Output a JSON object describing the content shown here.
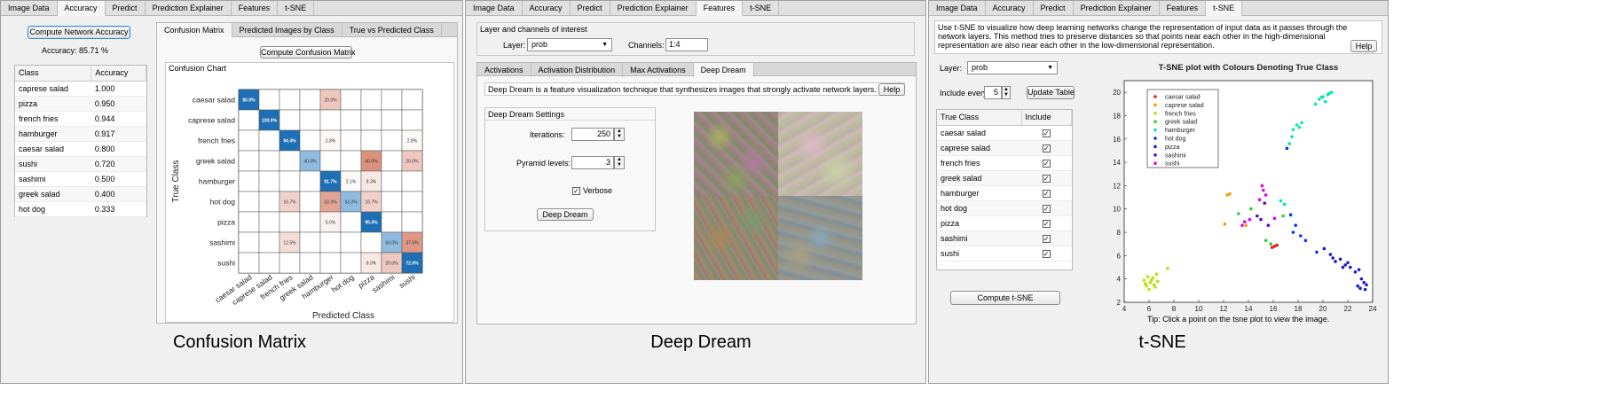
{
  "cm_panel": {
    "tabs": [
      "Image Data",
      "Accuracy",
      "Predict",
      "Prediction Explainer",
      "Features",
      "t-SNE"
    ],
    "active_tab": 1,
    "compute_btn": "Compute Network Accuracy",
    "accuracy_text": "Accuracy: 85.71 %",
    "table_headers": [
      "Class",
      "Accuracy"
    ],
    "table_rows": [
      [
        "caprese salad",
        "1.000"
      ],
      [
        "pizza",
        "0.950"
      ],
      [
        "french fries",
        "0.944"
      ],
      [
        "hamburger",
        "0.917"
      ],
      [
        "caesar salad",
        "0.800"
      ],
      [
        "sushi",
        "0.720"
      ],
      [
        "sashimi",
        "0.500"
      ],
      [
        "greek salad",
        "0.400"
      ],
      [
        "hot dog",
        "0.333"
      ]
    ],
    "subtabs": [
      "Confusion Matrix",
      "Predicted Images by Class",
      "True vs Predicted Class"
    ],
    "compute_cm_btn": "Compute Confusion Matrix",
    "chart_title": "Confusion Chart",
    "caption": "Confusion Matrix"
  },
  "chart_data": [
    {
      "type": "heatmap",
      "title": "Confusion Chart",
      "xlabel": "Predicted Class",
      "ylabel": "True Class",
      "classes": [
        "caesar salad",
        "caprese salad",
        "french fries",
        "greek salad",
        "hamburger",
        "hot dog",
        "pizza",
        "sashimi",
        "sushi"
      ],
      "cells": [
        {
          "row": 0,
          "col": 0,
          "v": "80.0%"
        },
        {
          "row": 0,
          "col": 4,
          "v": "20.0%"
        },
        {
          "row": 1,
          "col": 1,
          "v": "100.0%"
        },
        {
          "row": 2,
          "col": 2,
          "v": "94.4%"
        },
        {
          "row": 2,
          "col": 4,
          "v": "2.8%"
        },
        {
          "row": 2,
          "col": 8,
          "v": "2.8%"
        },
        {
          "row": 3,
          "col": 3,
          "v": "40.0%"
        },
        {
          "row": 3,
          "col": 6,
          "v": "40.0%"
        },
        {
          "row": 3,
          "col": 8,
          "v": "20.0%"
        },
        {
          "row": 4,
          "col": 4,
          "v": "91.7%"
        },
        {
          "row": 4,
          "col": 5,
          "v": "2.1%"
        },
        {
          "row": 4,
          "col": 6,
          "v": "8.3%"
        },
        {
          "row": 5,
          "col": 2,
          "v": "16.7%"
        },
        {
          "row": 5,
          "col": 4,
          "v": "33.3%"
        },
        {
          "row": 5,
          "col": 5,
          "v": "33.3%"
        },
        {
          "row": 5,
          "col": 6,
          "v": "16.7%"
        },
        {
          "row": 6,
          "col": 4,
          "v": "5.0%"
        },
        {
          "row": 6,
          "col": 6,
          "v": "95.0%"
        },
        {
          "row": 7,
          "col": 2,
          "v": "12.5%"
        },
        {
          "row": 7,
          "col": 7,
          "v": "50.0%"
        },
        {
          "row": 7,
          "col": 8,
          "v": "37.5%"
        },
        {
          "row": 8,
          "col": 6,
          "v": "8.0%"
        },
        {
          "row": 8,
          "col": 7,
          "v": "20.0%"
        },
        {
          "row": 8,
          "col": 8,
          "v": "72.0%"
        }
      ]
    },
    {
      "type": "scatter",
      "title": "T-SNE plot with Colours Denoting True Class",
      "xlim": [
        4,
        24
      ],
      "ylim": [
        2,
        21
      ],
      "xticks": [
        "4",
        "6",
        "8",
        "10",
        "12",
        "14",
        "16",
        "18",
        "20",
        "22",
        "24"
      ],
      "yticks": [
        "2",
        "4",
        "6",
        "8",
        "10",
        "12",
        "14",
        "16",
        "18",
        "20"
      ],
      "legend_position": "top-left",
      "series": [
        {
          "name": "caesar salad",
          "color": "#e41a1c",
          "points": [
            [
              16.1,
              6.8
            ],
            [
              16.3,
              6.9
            ],
            [
              15.9,
              6.7
            ]
          ]
        },
        {
          "name": "caprese salad",
          "color": "#ff9900",
          "points": [
            [
              12.3,
              11.2
            ],
            [
              12.5,
              11.3
            ],
            [
              13.8,
              8.6
            ],
            [
              12.1,
              8.7
            ]
          ]
        },
        {
          "name": "french fries",
          "color": "#b3e600",
          "points": [
            [
              5.8,
              3.4
            ],
            [
              6.1,
              3.7
            ],
            [
              6.4,
              3.5
            ],
            [
              5.6,
              3.9
            ],
            [
              6.7,
              3.8
            ],
            [
              5.9,
              4.2
            ],
            [
              6.3,
              4.1
            ],
            [
              6.0,
              3.1
            ],
            [
              6.5,
              3.3
            ],
            [
              5.7,
              3.6
            ],
            [
              6.2,
              3.9
            ],
            [
              7.5,
              4.9
            ],
            [
              6.6,
              4.4
            ]
          ]
        },
        {
          "name": "greek salad",
          "color": "#33cc33",
          "points": [
            [
              15.4,
              7.3
            ],
            [
              16.8,
              9.4
            ],
            [
              14.2,
              10.0
            ],
            [
              13.2,
              9.6
            ],
            [
              15.8,
              7.0
            ]
          ]
        },
        {
          "name": "hamburger",
          "color": "#00e6b8",
          "points": [
            [
              17.3,
              15.6
            ],
            [
              17.6,
              16.8
            ],
            [
              17.9,
              17.2
            ],
            [
              18.3,
              17.4
            ],
            [
              19.4,
              19.0
            ],
            [
              19.7,
              19.4
            ],
            [
              20.0,
              19.6
            ],
            [
              20.4,
              19.8
            ],
            [
              20.7,
              20.0
            ],
            [
              20.2,
              19.2
            ],
            [
              19.9,
              19.6
            ],
            [
              20.5,
              19.9
            ],
            [
              17.5,
              16.2
            ],
            [
              18.1,
              17.0
            ],
            [
              16.9,
              10.4
            ],
            [
              16.6,
              10.7
            ]
          ]
        },
        {
          "name": "hot dog",
          "color": "#0033ff",
          "points": [
            [
              17.1,
              15.2
            ],
            [
              17.4,
              9.5
            ],
            [
              17.8,
              8.6
            ],
            [
              18.2,
              7.7
            ],
            [
              18.6,
              7.3
            ],
            [
              17.6,
              8.0
            ],
            [
              19.5,
              6.3
            ]
          ]
        },
        {
          "name": "pizza",
          "color": "#1a1acc",
          "points": [
            [
              20.1,
              6.6
            ],
            [
              20.6,
              6.1
            ],
            [
              21.0,
              5.5
            ],
            [
              21.4,
              5.7
            ],
            [
              21.8,
              5.2
            ],
            [
              22.2,
              5.0
            ],
            [
              22.6,
              4.6
            ],
            [
              22.9,
              4.8
            ],
            [
              23.1,
              4.0
            ],
            [
              23.3,
              3.7
            ],
            [
              23.5,
              3.5
            ],
            [
              22.8,
              3.4
            ],
            [
              23.0,
              3.2
            ],
            [
              21.6,
              5.0
            ],
            [
              22.0,
              5.4
            ],
            [
              20.8,
              5.8
            ],
            [
              23.4,
              3.1
            ]
          ]
        },
        {
          "name": "sashimi",
          "color": "#6600cc",
          "points": [
            [
              15.0,
              9.1
            ],
            [
              15.3,
              10.5
            ],
            [
              14.7,
              9.4
            ],
            [
              15.6,
              8.6
            ]
          ]
        },
        {
          "name": "sushi",
          "color": "#e600e6",
          "points": [
            [
              15.1,
              12.0
            ],
            [
              15.2,
              11.6
            ],
            [
              15.4,
              11.2
            ],
            [
              14.9,
              10.8
            ],
            [
              13.7,
              8.9
            ],
            [
              13.5,
              8.6
            ],
            [
              16.1,
              9.2
            ],
            [
              14.1,
              9.1
            ]
          ]
        }
      ]
    }
  ],
  "dd_panel": {
    "tabs": [
      "Image Data",
      "Accuracy",
      "Predict",
      "Prediction Explainer",
      "Features",
      "t-SNE"
    ],
    "active_tab": 4,
    "group_title": "Layer and channels of interest",
    "layer_label": "Layer:",
    "layer_value": "prob",
    "channels_label": "Channels:",
    "channels_value": "1:4",
    "subtabs": [
      "Activations",
      "Activation Distribution",
      "Max Activations",
      "Deep Dream"
    ],
    "description": "Deep Dream is a feature visualization technique that synthesizes images that strongly activate network layers.",
    "help": "Help",
    "settings_title": "Deep Dream Settings",
    "iterations_label": "Iterations:",
    "iterations_value": "250",
    "pyramid_label": "Pyramid levels:",
    "pyramid_value": "3",
    "verbose_label": "Verbose",
    "deep_dream_btn": "Deep Dream",
    "caption": "Deep Dream"
  },
  "tsne_panel": {
    "tabs": [
      "Image Data",
      "Accuracy",
      "Predict",
      "Prediction Explainer",
      "Features",
      "t-SNE"
    ],
    "active_tab": 5,
    "description": "Use t-SNE to visualize how deep learning networks change the representation of input data as it passes through the network layers. This method tries to preserve distances so that points near each other in the high-dimensional representation are also near each other in the low-dimensional representation.",
    "help": "Help",
    "layer_label": "Layer:",
    "layer_value": "prob",
    "include_label": "Include every",
    "include_value": "5",
    "update_btn": "Update Table",
    "table_headers": [
      "True Class",
      "Include"
    ],
    "table_rows": [
      "caesar salad",
      "caprese salad",
      "french fries",
      "greek salad",
      "hamburger",
      "hot dog",
      "pizza",
      "sashimi",
      "sushi"
    ],
    "compute_btn": "Compute t-SNE",
    "tip": "Tip: Click a point on the tsne plot to view the image.",
    "caption": "t-SNE"
  }
}
